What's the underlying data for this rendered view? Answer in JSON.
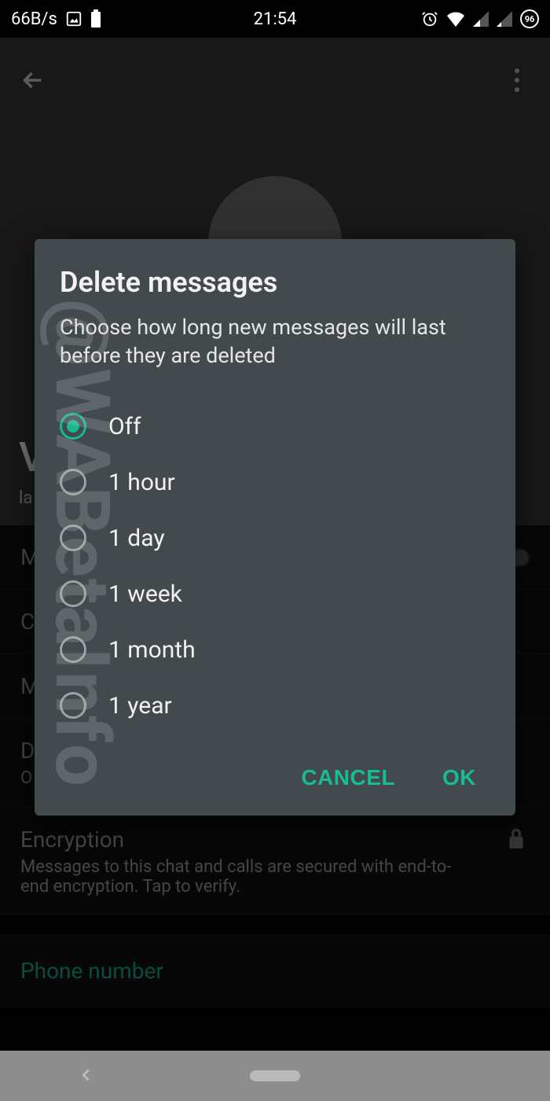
{
  "status_bar": {
    "net_speed": "66B/s",
    "time": "21:54",
    "battery_badge": "96"
  },
  "page": {
    "contact_initial": "V",
    "last_seen_prefix": "la",
    "rows": {
      "m1": "M",
      "c": "C",
      "m2": "M",
      "d": "D",
      "d_sub": "O"
    },
    "encryption": {
      "title": "Encryption",
      "body": "Messages to this chat and calls are secured with end-to-end encryption. Tap to verify."
    },
    "phone_section": "Phone number"
  },
  "dialog": {
    "title": "Delete messages",
    "description": "Choose how long new messages will last before they are deleted",
    "options": [
      {
        "label": "Off",
        "checked": true
      },
      {
        "label": "1 hour",
        "checked": false
      },
      {
        "label": "1 day",
        "checked": false
      },
      {
        "label": "1 week",
        "checked": false
      },
      {
        "label": "1 month",
        "checked": false
      },
      {
        "label": "1 year",
        "checked": false
      }
    ],
    "cancel": "CANCEL",
    "ok": "OK"
  },
  "watermark": "@WABetaInfo"
}
